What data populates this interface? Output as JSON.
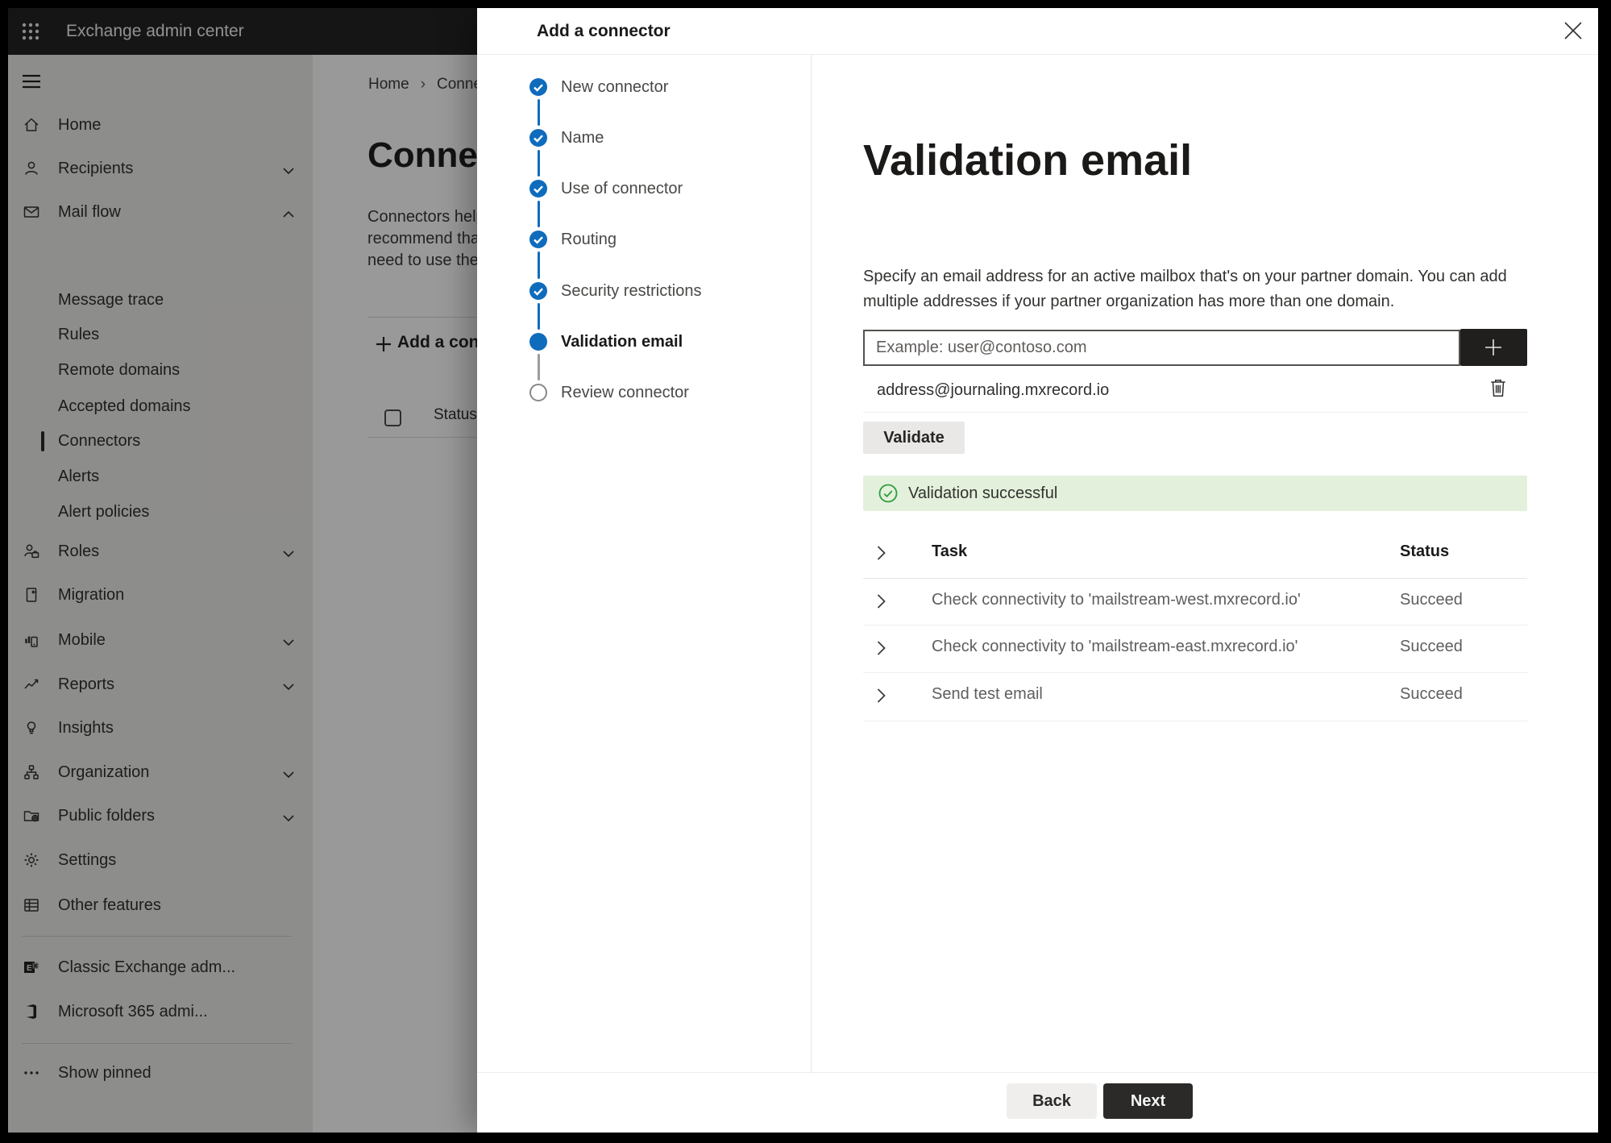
{
  "app_bar": {
    "title": "Exchange admin center"
  },
  "breadcrumb": {
    "home": "Home",
    "separator": "›",
    "current_fragment": "Conne"
  },
  "page": {
    "title_fragment": "Connec",
    "description_lines": [
      "Connectors help",
      "recommend that",
      "need to use ther"
    ],
    "add_connector_fragment": "Add a conn",
    "list_header_status": "Status"
  },
  "sidebar": {
    "items": [
      {
        "label": "Home"
      },
      {
        "label": "Recipients"
      },
      {
        "label": "Mail flow"
      },
      {
        "label": "Message trace"
      },
      {
        "label": "Rules"
      },
      {
        "label": "Remote domains"
      },
      {
        "label": "Accepted domains"
      },
      {
        "label": "Connectors"
      },
      {
        "label": "Alerts"
      },
      {
        "label": "Alert policies"
      },
      {
        "label": "Roles"
      },
      {
        "label": "Migration"
      },
      {
        "label": "Mobile"
      },
      {
        "label": "Reports"
      },
      {
        "label": "Insights"
      },
      {
        "label": "Organization"
      },
      {
        "label": "Public folders"
      },
      {
        "label": "Settings"
      },
      {
        "label": "Other features"
      },
      {
        "label": "Classic Exchange adm..."
      },
      {
        "label": "Microsoft 365 admi..."
      },
      {
        "label": "Show pinned"
      }
    ]
  },
  "dialog": {
    "title": "Add a connector",
    "steps": [
      {
        "label": "New connector",
        "state": "done"
      },
      {
        "label": "Name",
        "state": "done"
      },
      {
        "label": "Use of connector",
        "state": "done"
      },
      {
        "label": "Routing",
        "state": "done"
      },
      {
        "label": "Security restrictions",
        "state": "done"
      },
      {
        "label": "Validation email",
        "state": "current"
      },
      {
        "label": "Review connector",
        "state": "todo"
      }
    ],
    "content": {
      "heading": "Validation email",
      "description_lines": [
        "Specify an email address for an active mailbox that's on your partner domain. You can add",
        "multiple addresses if your partner organization has more than one domain."
      ],
      "email_input_placeholder": "Example: user@contoso.com",
      "address": "address@journaling.mxrecord.io",
      "validate_button": "Validate",
      "banner_text": "Validation successful",
      "table": {
        "columns": {
          "task": "Task",
          "status": "Status"
        },
        "rows": [
          {
            "task": "Check connectivity to 'mailstream-west.mxrecord.io'",
            "status": "Succeed"
          },
          {
            "task": "Check connectivity to 'mailstream-east.mxrecord.io'",
            "status": "Succeed"
          },
          {
            "task": "Send test email",
            "status": "Succeed"
          }
        ]
      }
    },
    "footer": {
      "back": "Back",
      "next": "Next"
    }
  },
  "colors": {
    "accent_blue": "#0f6cbd",
    "success_green": "#2f9c3c",
    "success_bg": "#e3f1dc",
    "primary_button": "#2b2a28",
    "appbar_bg": "#252423"
  }
}
